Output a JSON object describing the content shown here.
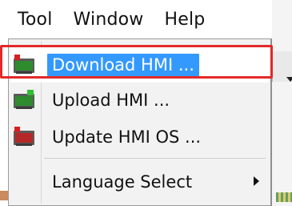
{
  "menubar": {
    "items": [
      "Tool",
      "Window",
      "Help"
    ]
  },
  "menu": {
    "items": [
      {
        "label": "Download HMI ...",
        "icon": "download-hmi-icon",
        "highlighted": true
      },
      {
        "label": "Upload HMI ...",
        "icon": "upload-hmi-icon",
        "highlighted": false
      },
      {
        "label": "Update HMI OS ...",
        "icon": "update-hmi-os-icon",
        "highlighted": false
      },
      {
        "label": "Language Select",
        "icon": "",
        "submenu": true
      }
    ]
  },
  "colors": {
    "highlight": "#3399ff",
    "annotation_border": "#e22a2a"
  }
}
